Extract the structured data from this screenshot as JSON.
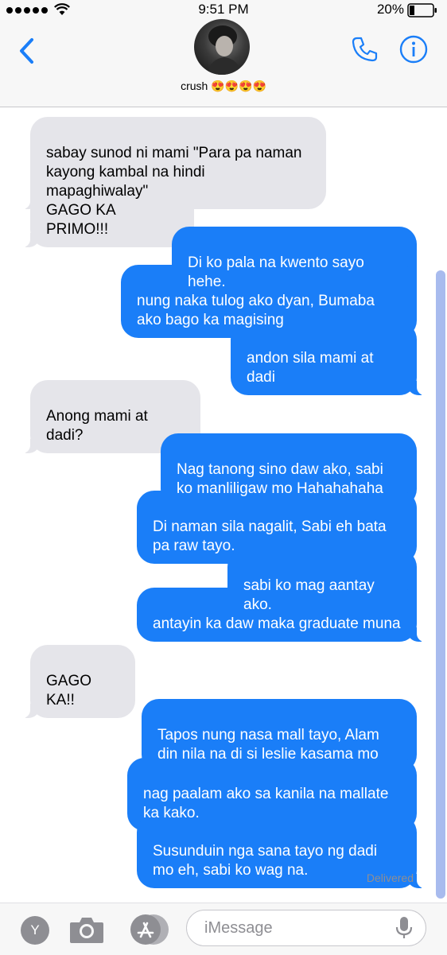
{
  "status_bar": {
    "time": "9:51 PM",
    "battery_percent": "20%"
  },
  "header": {
    "contact_name": "crush 😍😍😍😍",
    "icons": {
      "back": "chevron-left-icon",
      "call": "phone-icon",
      "info": "info-icon"
    },
    "accent_color": "#1a7ef8"
  },
  "messages": [
    {
      "sender": "them",
      "text": "sabay sunod ni mami \"Para pa naman kayong kambal na hindi mapaghiwalay\""
    },
    {
      "sender": "them",
      "text": "GAGO KA PRIMO!!!"
    },
    {
      "sender": "me",
      "text": "Di ko pala na kwento sayo hehe."
    },
    {
      "sender": "me",
      "text": "nung naka tulog ako dyan, Bumaba ako bago ka magising"
    },
    {
      "sender": "me",
      "text": "andon sila mami at dadi"
    },
    {
      "sender": "them",
      "text": "Anong mami at dadi?"
    },
    {
      "sender": "me",
      "text": "Nag tanong sino daw ako, sabi ko manliligaw mo Hahahahaha"
    },
    {
      "sender": "me",
      "text": "Di naman sila nagalit, Sabi eh bata pa raw tayo."
    },
    {
      "sender": "me",
      "text": "sabi ko mag aantay ako."
    },
    {
      "sender": "me",
      "text": "antayin ka daw maka graduate muna"
    },
    {
      "sender": "them",
      "text": "GAGO KA!!"
    },
    {
      "sender": "me",
      "text": "Tapos nung nasa mall tayo, Alam din nila na di si leslie kasama mo"
    },
    {
      "sender": "me",
      "text": "nag paalam ako sa kanila na mallate ka kako."
    },
    {
      "sender": "me",
      "text": "Susunduin nga sana tayo ng dadi mo eh, sabi ko wag na."
    }
  ],
  "delivered_label": "Delivered",
  "input_bar": {
    "app_button_label": "Y",
    "placeholder": "iMessage",
    "icons": {
      "camera": "camera-icon",
      "app_store": "app-store-icon",
      "mic": "microphone-icon"
    }
  },
  "colors": {
    "sent_bubble": "#1a7ef8",
    "received_bubble": "#e5e5ea"
  }
}
